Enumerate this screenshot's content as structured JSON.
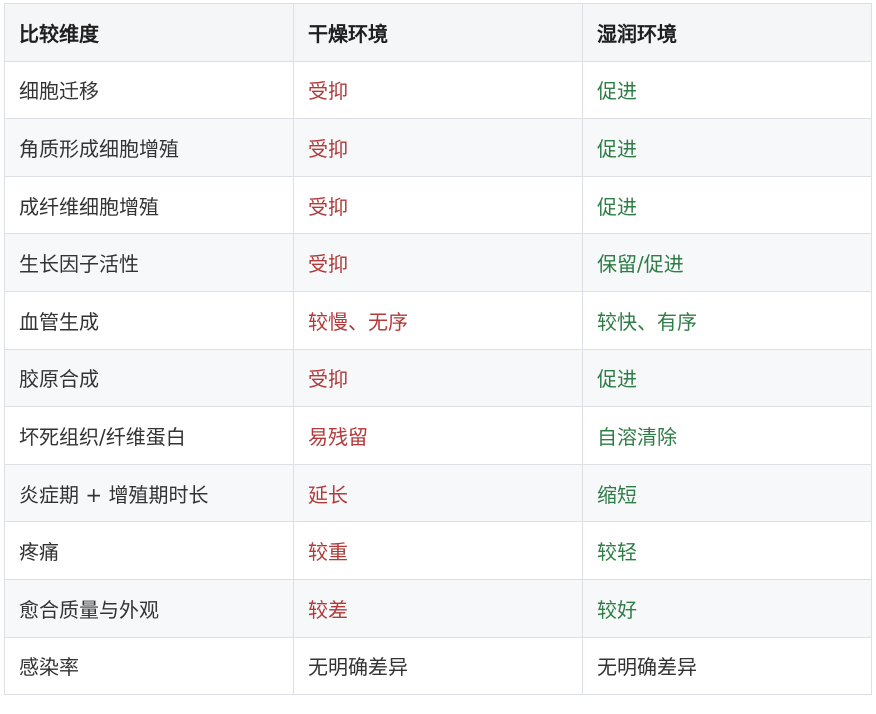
{
  "table": {
    "headers": [
      "比较维度",
      "干燥环境",
      "湿润环境"
    ],
    "rows": [
      {
        "dimension": "细胞迁移",
        "dry": "受抑",
        "moist": "促进",
        "tone": "contrast"
      },
      {
        "dimension": "角质形成细胞增殖",
        "dry": "受抑",
        "moist": "促进",
        "tone": "contrast"
      },
      {
        "dimension": "成纤维细胞增殖",
        "dry": "受抑",
        "moist": "促进",
        "tone": "contrast"
      },
      {
        "dimension": "生长因子活性",
        "dry": "受抑",
        "moist": "保留/促进",
        "tone": "contrast"
      },
      {
        "dimension": "血管生成",
        "dry": "较慢、无序",
        "moist": "较快、有序",
        "tone": "contrast"
      },
      {
        "dimension": "胶原合成",
        "dry": "受抑",
        "moist": "促进",
        "tone": "contrast"
      },
      {
        "dimension": "坏死组织/纤维蛋白",
        "dry": "易残留",
        "moist": "自溶清除",
        "tone": "contrast"
      },
      {
        "dimension": "炎症期 + 增殖期时长",
        "dry": "延长",
        "moist": "缩短",
        "tone": "contrast"
      },
      {
        "dimension": "疼痛",
        "dry": "较重",
        "moist": "较轻",
        "tone": "contrast"
      },
      {
        "dimension": "愈合质量与外观",
        "dry": "较差",
        "moist": "较好",
        "tone": "contrast"
      },
      {
        "dimension": "感染率",
        "dry": "无明确差异",
        "moist": "无明确差异",
        "tone": "neutral"
      }
    ]
  },
  "colors": {
    "negative": "#b23a3a",
    "positive": "#2e7d46",
    "neutral": "#333333",
    "border": "#dcdfe4",
    "header_bg": "#f5f6f8",
    "stripe_bg": "#f7f8fa"
  }
}
